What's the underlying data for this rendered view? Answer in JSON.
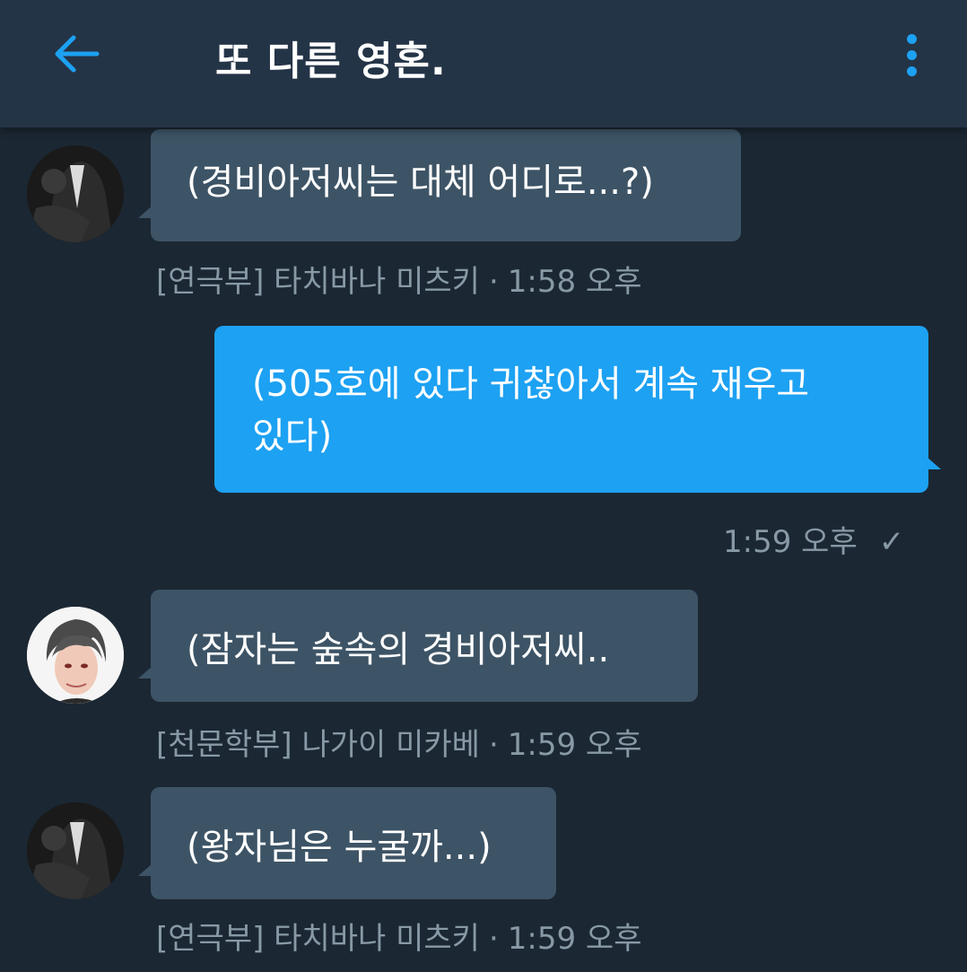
{
  "header": {
    "title": "또 다른 영혼."
  },
  "messages": [
    {
      "text": "(경비아저씨는 대체 어디로...?)",
      "sender": "[연극부] 타치바나 미츠키",
      "time": "1:58 오후"
    },
    {
      "text_line1": "(505호에 있다 귀찮아서 계속 재우고",
      "text_line2": "있다)",
      "time": "1:59 오후",
      "status_icon": "✓"
    },
    {
      "text": "(잠자는 숲속의 경비아저씨..",
      "sender": "[천문학부] 나가이 미카베",
      "time": "1:59 오후"
    },
    {
      "text": "(왕자님은 누굴까...)",
      "sender": "[연극부] 타치바나 미츠키",
      "time": "1:59 오후"
    }
  ],
  "separator": "·",
  "colors": {
    "accent": "#1da1f2",
    "background": "#1b2733",
    "header": "#243447",
    "incoming_bubble": "#3d5466",
    "meta_text": "#8899a6"
  }
}
